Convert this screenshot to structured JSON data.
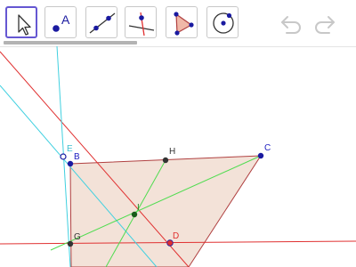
{
  "toolbar": {
    "tools": [
      {
        "name": "move-tool",
        "icon": "arrow-pointer-icon",
        "active": true
      },
      {
        "name": "point-tool",
        "icon": "point-icon",
        "label": "A"
      },
      {
        "name": "line-tool",
        "icon": "line-through-points-icon"
      },
      {
        "name": "perpendicular-line-tool",
        "icon": "perpendicular-line-icon"
      },
      {
        "name": "polygon-tool",
        "icon": "triangle-icon"
      },
      {
        "name": "circle-tool",
        "icon": "circle-center-point-icon"
      }
    ],
    "undo_icon": "undo-icon",
    "redo_icon": "redo-icon"
  },
  "colors": {
    "accent": "#6557d2",
    "point": "#1a1aa0",
    "label": "#2020c0",
    "red_line": "#e03030",
    "cyan_line": "#40d0e0",
    "green_line": "#50dc50",
    "triangle_fill": "#f3e2d8",
    "triangle_stroke": "#b04040",
    "axis_line": "#e03030"
  },
  "points": {
    "A": "A",
    "B": "B",
    "C": "C",
    "D": "D",
    "E": "E",
    "G": "G",
    "H": "H",
    "I": "I"
  }
}
